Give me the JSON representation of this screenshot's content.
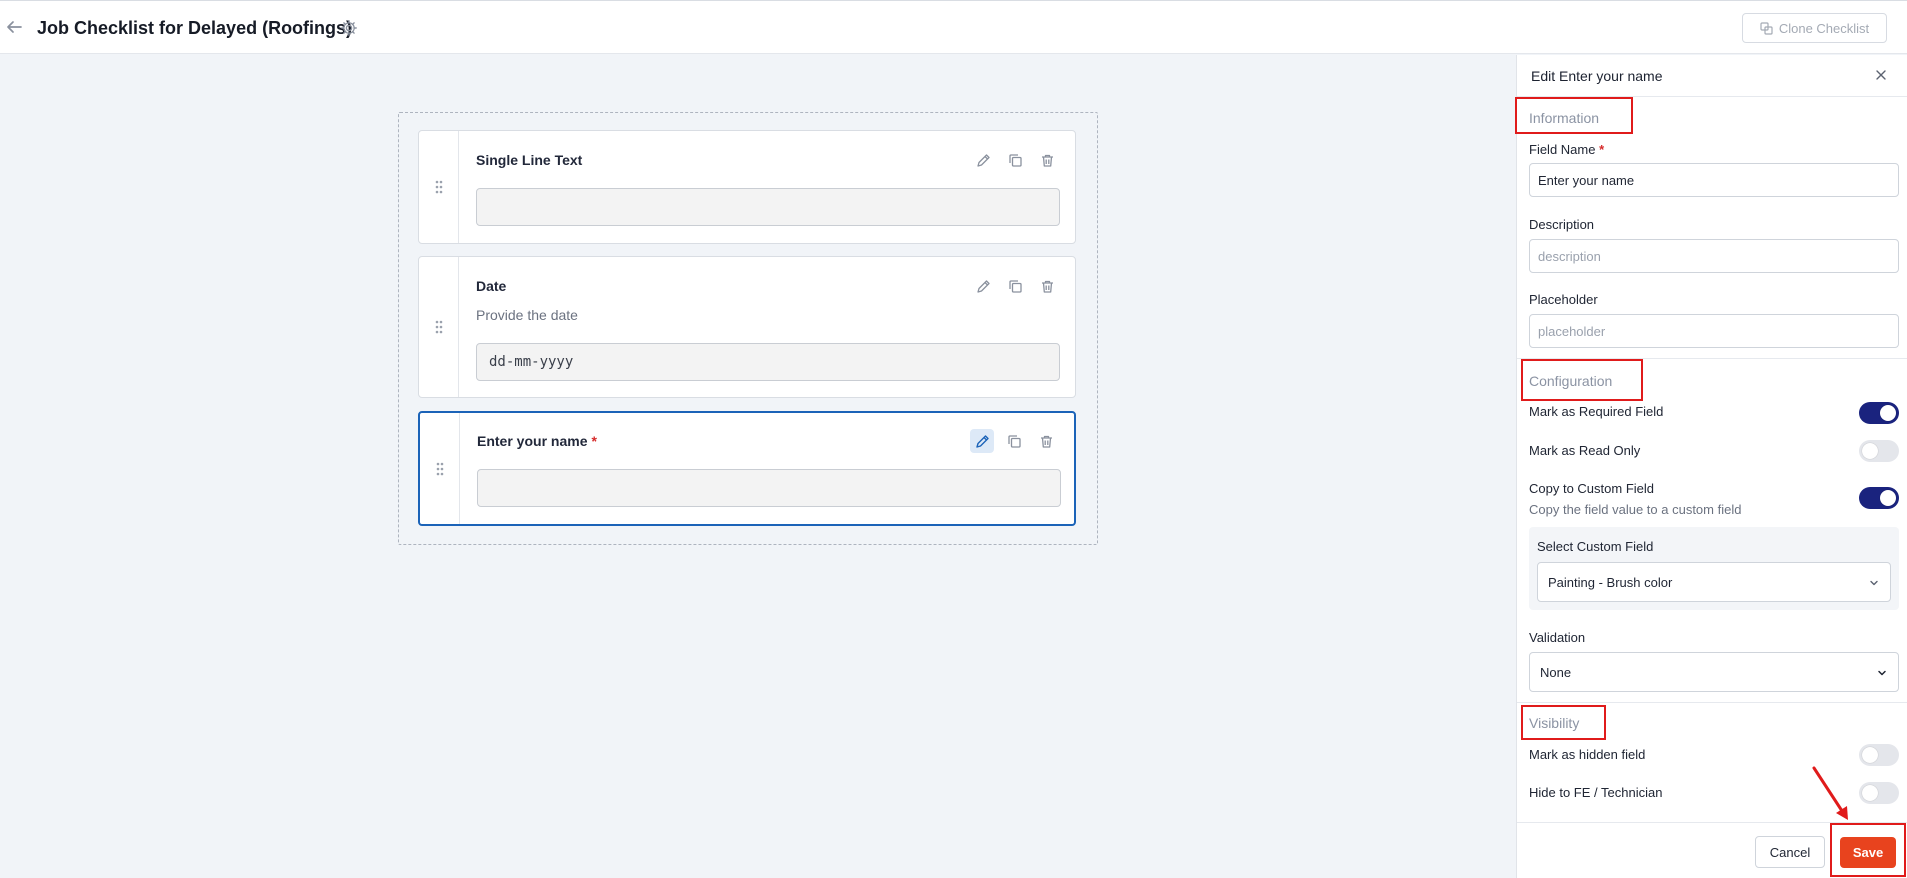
{
  "header": {
    "title": "Job Checklist for Delayed (Roofings)",
    "clone_label": "Clone Checklist"
  },
  "fields": [
    {
      "label": "Single Line Text",
      "required": false,
      "description": "",
      "input_value": ""
    },
    {
      "label": "Date",
      "required": false,
      "description": "Provide the date",
      "input_value": "dd-mm-yyyy"
    },
    {
      "label": "Enter your name",
      "required": true,
      "required_mark": "*",
      "description": "",
      "input_value": ""
    }
  ],
  "panel": {
    "title": "Edit Enter your name",
    "information": {
      "section_title": "Information",
      "field_name_label": "Field Name",
      "field_name_required_mark": "*",
      "field_name_value": "Enter your name",
      "description_label": "Description",
      "description_placeholder": "description",
      "placeholder_label": "Placeholder",
      "placeholder_placeholder": "placeholder"
    },
    "configuration": {
      "section_title": "Configuration",
      "required_label": "Mark as Required Field",
      "required_on": true,
      "read_only_label": "Mark as Read Only",
      "read_only_on": false,
      "copy_label": "Copy to Custom Field",
      "copy_desc": "Copy the field value to a custom field",
      "copy_on": true,
      "select_custom_label": "Select Custom Field",
      "select_custom_value": "Painting - Brush color",
      "validation_label": "Validation",
      "validation_value": "None"
    },
    "visibility": {
      "section_title": "Visibility",
      "hidden_label": "Mark as hidden field",
      "hidden_on": false,
      "hide_fe_label": "Hide to FE / Technician",
      "hide_fe_on": false
    },
    "cancel_label": "Cancel",
    "save_label": "Save"
  },
  "colors": {
    "primary_toggle": "#1a237e",
    "save_button": "#e8431e",
    "selected_border": "#1b63b8",
    "annotation_red": "#e01b1b"
  }
}
